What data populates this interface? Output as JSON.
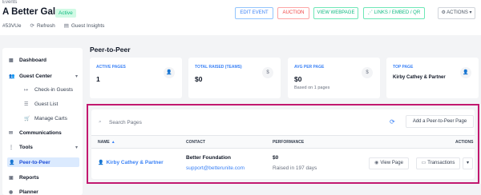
{
  "header": {
    "breadcrumb": "Events",
    "title": "A Better Gala",
    "status": "Active",
    "event_code": "#53VUe",
    "refresh_label": "Refresh",
    "insights_label": "Guest Insights"
  },
  "header_buttons": {
    "edit_event": "EDIT EVENT",
    "auction": "AUCTION",
    "view_webpage": "VIEW WEBPAGE",
    "links_embed_qr": "LINKS / EMBED / QR",
    "actions": "ACTIONS"
  },
  "sidebar": {
    "items": [
      {
        "label": "Dashboard",
        "icon": "grid-icon"
      },
      {
        "label": "Guest Center",
        "icon": "users-icon"
      },
      {
        "label": "Check-in Guests",
        "icon": "checkin-icon"
      },
      {
        "label": "Guest List",
        "icon": "list-icon"
      },
      {
        "label": "Manage Carts",
        "icon": "cart-icon"
      },
      {
        "label": "Communications",
        "icon": "chat-icon"
      },
      {
        "label": "Tools",
        "icon": "tools-icon"
      },
      {
        "label": "Peer-to-Peer",
        "icon": "people-icon"
      },
      {
        "label": "Reports",
        "icon": "report-icon"
      },
      {
        "label": "Planner",
        "icon": "planner-icon"
      }
    ]
  },
  "page": {
    "title": "Peer-to-Peer"
  },
  "stats": [
    {
      "label": "ACTIVE PAGES",
      "value": "1",
      "note": "",
      "icon": "user-plus-icon"
    },
    {
      "label": "TOTAL RAISED (TEAMS)",
      "value": "$0",
      "note": "",
      "icon": "dollar-icon"
    },
    {
      "label": "AVG PER PAGE",
      "value": "$0",
      "note": "Based on 1 pages",
      "icon": "dollar-icon"
    },
    {
      "label": "TOP PAGE",
      "value": "Kirby Cathey & Partner",
      "note": "",
      "icon": "user-plus-icon"
    }
  ],
  "table": {
    "search_placeholder": "Search Pages",
    "add_button": "Add a Peer-to-Peer Page",
    "columns": {
      "name": "NAME",
      "contact": "CONTACT",
      "performance": "PERFORMANCE",
      "actions": "ACTIONS"
    },
    "rows": [
      {
        "name": "Kirby Cathey & Partner",
        "contact_name": "Better Foundation",
        "contact_email": "support@betterunite.com",
        "amount": "$0",
        "raised_note": "Raised in 197 days",
        "view_label": "View Page",
        "transactions_label": "Transactions"
      }
    ]
  },
  "colors": {
    "accent": "#3b82f6",
    "highlight_border": "#c2186f",
    "success": "#10b981",
    "danger": "#ef4444"
  }
}
